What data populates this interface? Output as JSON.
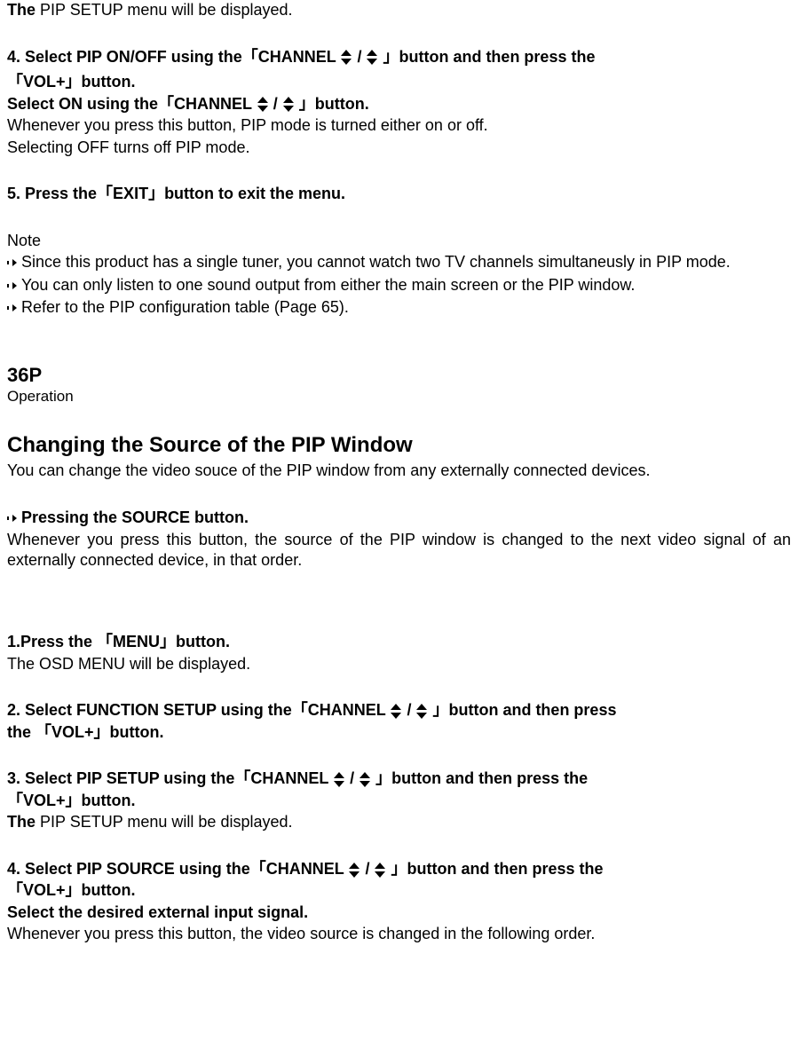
{
  "top_line_prefix_bold": "The",
  "top_line_rest": " PIP SETUP menu will be displayed.",
  "step4a_pre": "4. Select PIP ON/OFF using the「CHANNEL",
  "step4a_mid": " / ",
  "step4a_post": " 」button and then press the",
  "step4a_line2": "「VOL+」button.",
  "step4b_pre": " Select ON using the「CHANNEL",
  "step4b_mid": " / ",
  "step4b_post": " 」button.",
  "step4b_body1": " Whenever you press this button, PIP mode is turned either on or off.",
  "step4b_body2": " Selecting OFF turns off PIP mode.",
  "step5": "5. Press the「EXIT」button to exit the menu.",
  "note_heading": "Note",
  "note1": "Since this product has a single tuner, you cannot watch two TV channels simultaneusly in PIP mode.",
  "note2": "You can only listen to one sound output from either the main screen or the PIP window.",
  "note3": "Refer to the PIP configuration table (Page 65).",
  "pg": "36P",
  "pg_sub": "Operation",
  "h2": "Changing the Source of the PIP Window",
  "h2_sub": "You can change the video souce of the PIP window from any externally connected devices.",
  "press_src_head": "Pressing the SOURCE button.",
  "press_src_body": "  Whenever you press this button, the source of the PIP window is changed to the next video signal of an externally connected device, in that order.",
  "b_step1": "1.Press the 「MENU」button.",
  "b_step1_body": " The OSD MENU will be displayed.",
  "b_step2_pre": "2. Select FUNCTION SETUP using the「CHANNEL",
  "b_step2_mid": " / ",
  "b_step2_post": " 」button and then press",
  "b_step2_line2": "the 「VOL+」button.",
  "b_step3_pre": "3. Select PIP SETUP using the「CHANNEL",
  "b_step3_mid": " / ",
  "b_step3_post": " 」button and then press the",
  "b_step3_line2": "「VOL+」button.",
  "b_step3_body_prefix_bold": "The",
  "b_step3_body_rest": " PIP SETUP menu will be displayed.",
  "b_step4_pre": "4.  Select PIP SOURCE using the「CHANNEL",
  "b_step4_mid": " / ",
  "b_step4_post": " 」button and then press the",
  "b_step4_line2": "「VOL+」button.",
  "b_step4_sub": "  Select the desired external input signal.",
  "b_step4_body": "  Whenever you press this button, the video source is changed in the following order."
}
